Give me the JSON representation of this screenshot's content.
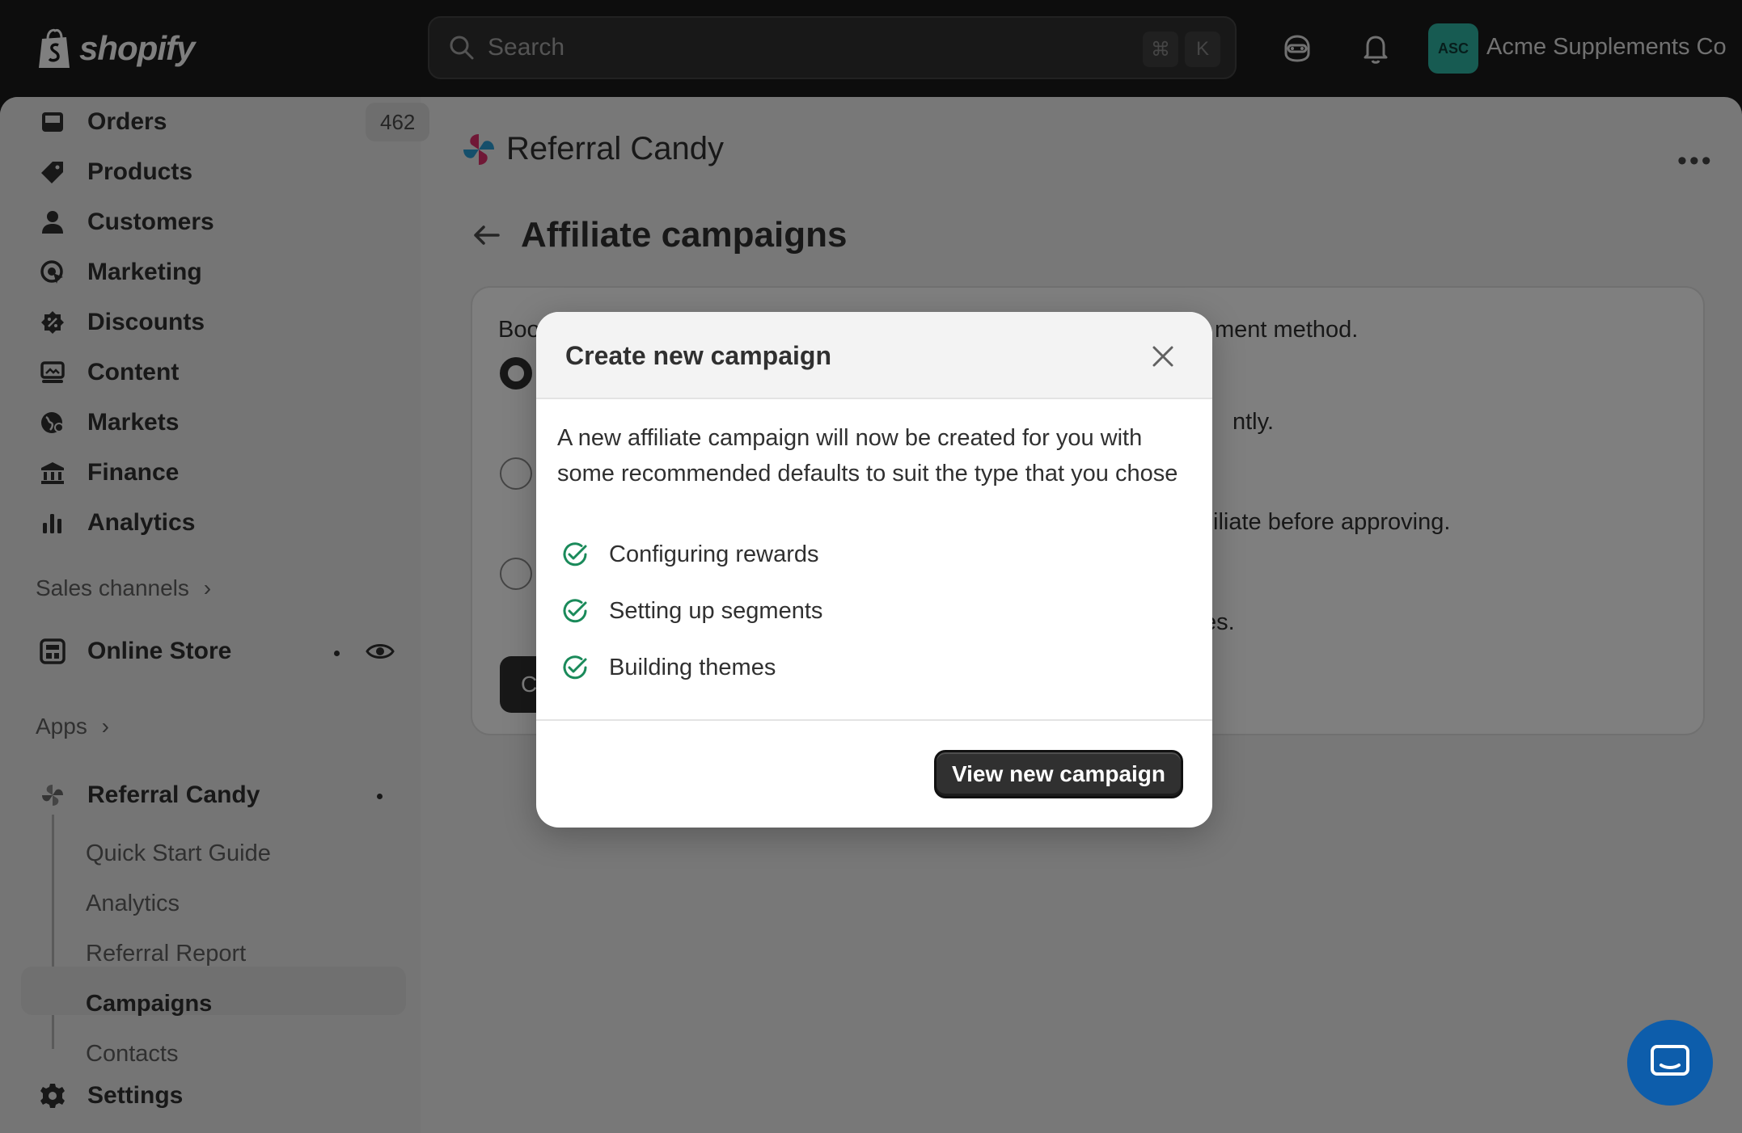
{
  "topbar": {
    "brand": "shopify",
    "search_placeholder": "Search",
    "shortcut_keys": [
      "⌘",
      "K"
    ],
    "avatar_initials": "ASC",
    "store_name": "Acme Supplements Co",
    "avatar_color": "#2fb6a4"
  },
  "sidebar": {
    "nav": [
      {
        "label": "Orders",
        "icon": "inbox-icon",
        "badge": "462"
      },
      {
        "label": "Products",
        "icon": "tag-icon"
      },
      {
        "label": "Customers",
        "icon": "person-icon"
      },
      {
        "label": "Marketing",
        "icon": "target-icon"
      },
      {
        "label": "Discounts",
        "icon": "discount-icon"
      },
      {
        "label": "Content",
        "icon": "content-icon"
      },
      {
        "label": "Markets",
        "icon": "globe-icon"
      },
      {
        "label": "Finance",
        "icon": "bank-icon"
      },
      {
        "label": "Analytics",
        "icon": "bar-chart-icon"
      }
    ],
    "sales_channels_label": "Sales channels",
    "online_store_label": "Online Store",
    "apps_label": "Apps",
    "app_name": "Referral Candy",
    "app_subitems": [
      "Quick Start Guide",
      "Analytics",
      "Referral Report",
      "Campaigns",
      "Contacts"
    ],
    "settings_label": "Settings"
  },
  "main": {
    "app_title": "Referral Candy",
    "page_title": "Affiliate campaigns",
    "card": {
      "line1_left": "Boo",
      "line1_right": "ment method.",
      "line2_right": "ntly.",
      "line3_right": "iliate before approving.",
      "line4_right": "es.",
      "button_partial": "C"
    }
  },
  "modal": {
    "title": "Create new campaign",
    "body": "A new affiliate campaign will now be created for you with some recommended defaults to suit the type that you chose",
    "steps": [
      "Configuring rewards",
      "Setting up segments",
      "Building themes"
    ],
    "primary_button": "View new campaign",
    "accent_color": "#1a8a5a"
  }
}
